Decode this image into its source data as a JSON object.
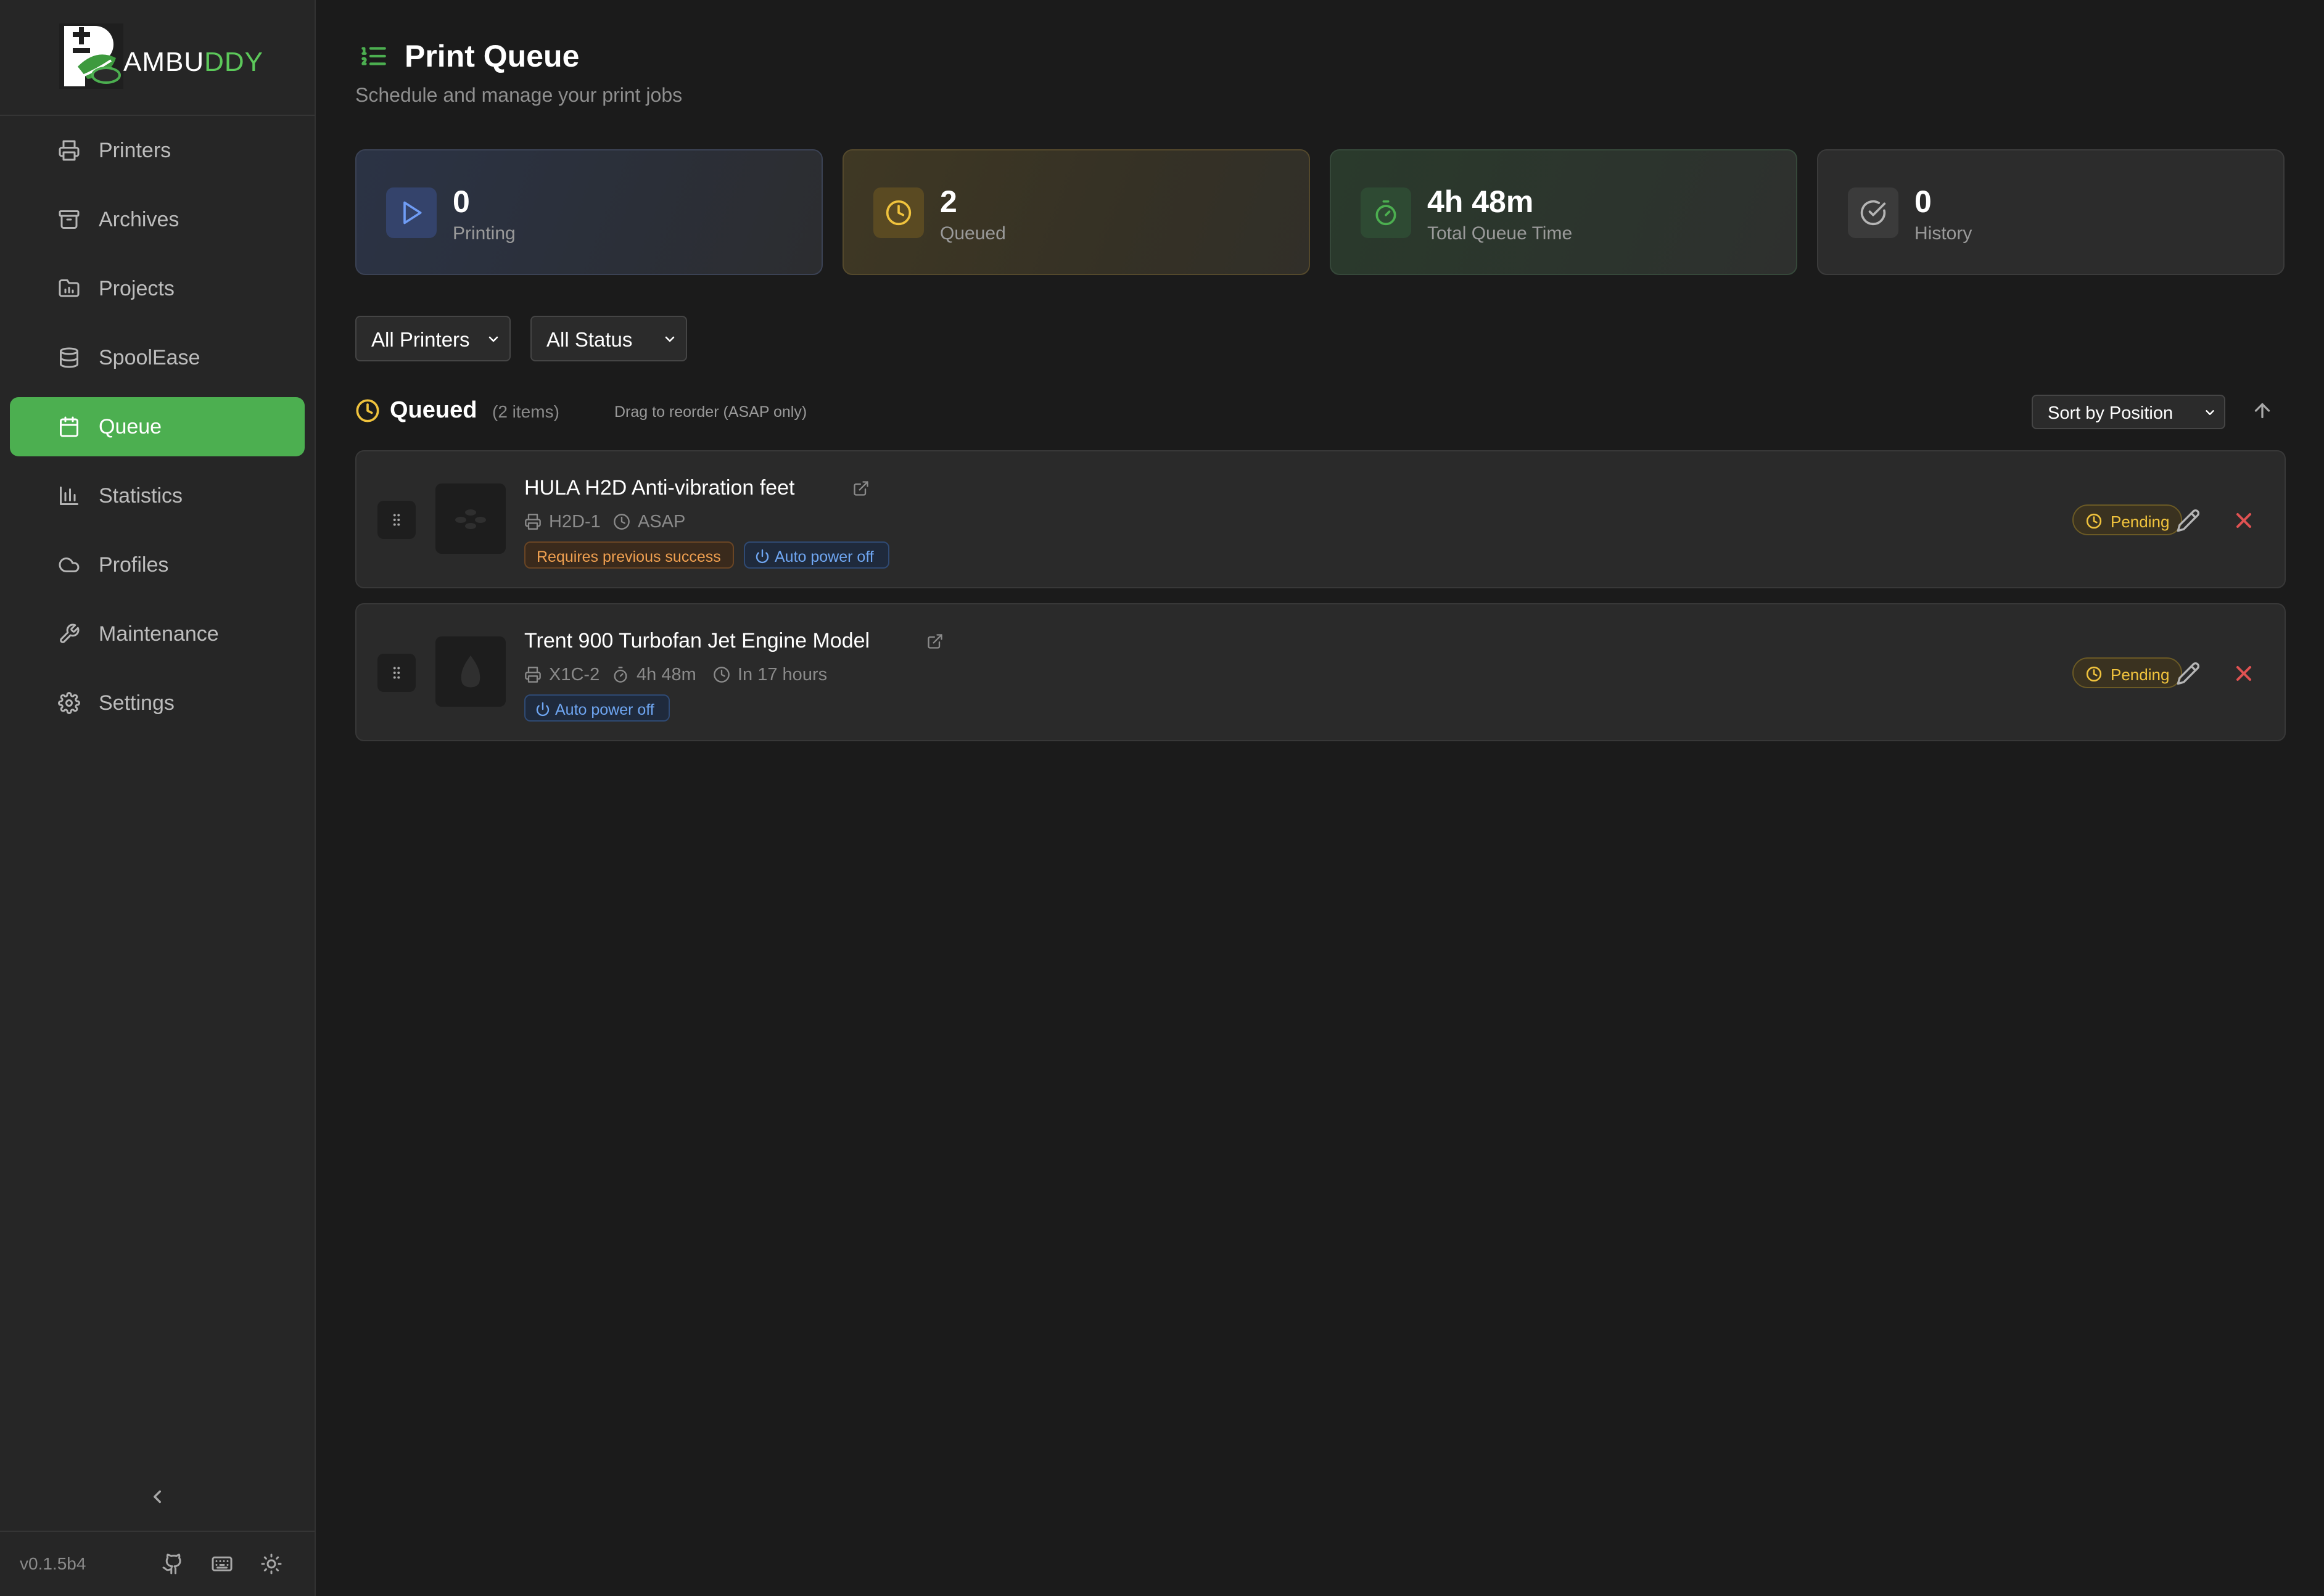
{
  "app": {
    "logo_prefix": "AMBU",
    "logo_suffix": "DDY",
    "version": "v0.1.5b4"
  },
  "sidebar": {
    "items": [
      {
        "label": "Printers",
        "icon": "printer-icon"
      },
      {
        "label": "Archives",
        "icon": "archive-icon"
      },
      {
        "label": "Projects",
        "icon": "folder-icon"
      },
      {
        "label": "SpoolEase",
        "icon": "spool-icon"
      },
      {
        "label": "Queue",
        "icon": "calendar-icon",
        "active": true
      },
      {
        "label": "Statistics",
        "icon": "bar-chart-icon"
      },
      {
        "label": "Profiles",
        "icon": "cloud-icon"
      },
      {
        "label": "Maintenance",
        "icon": "wrench-icon"
      },
      {
        "label": "Settings",
        "icon": "gear-icon"
      }
    ]
  },
  "page": {
    "title": "Print Queue",
    "subtitle": "Schedule and manage your print jobs"
  },
  "stats": {
    "printing": {
      "value": "0",
      "label": "Printing"
    },
    "queued": {
      "value": "2",
      "label": "Queued"
    },
    "total_time": {
      "value": "4h 48m",
      "label": "Total Queue Time"
    },
    "history": {
      "value": "0",
      "label": "History"
    }
  },
  "filters": {
    "printers": "All Printers",
    "status": "All Status"
  },
  "section": {
    "title": "Queued",
    "count": "(2 items)",
    "hint": "Drag to reorder (ASAP only)",
    "sort": "Sort by Position"
  },
  "queue": [
    {
      "title": "HULA H2D Anti-vibration feet",
      "printer": "H2D-1",
      "schedule": "ASAP",
      "tags": [
        "Requires previous success",
        "Auto power off"
      ],
      "status": "Pending"
    },
    {
      "title": "Trent 900 Turbofan Jet Engine Model",
      "printer": "X1C-2",
      "duration": "4h 48m",
      "schedule": "In 17 hours",
      "tags": [
        "Auto power off"
      ],
      "status": "Pending"
    }
  ],
  "colors": {
    "accent": "#4caf50",
    "pending": "#f0c33d",
    "danger": "#e05252",
    "info": "#6fa6f2"
  }
}
